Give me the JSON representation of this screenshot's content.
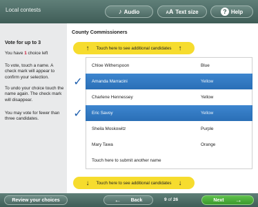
{
  "topbar": {
    "title": "Local contests",
    "audio_label": "Audio",
    "textsize_prefix": "A",
    "textsize_big": "A",
    "textsize_label": "Text size",
    "help_label": "Help",
    "help_symbol": "?"
  },
  "sidebar": {
    "heading": "Vote for up to 3",
    "choice_prefix": "You have ",
    "choice_count": "1",
    "choice_suffix": " choice left",
    "instruction_1": "To vote, touch a name. A check mark will appear to confirm your selection.",
    "instruction_2": "To undo your choice touch the name again. The check mark will disappear.",
    "instruction_3": "You may vote for fewer than three candidates."
  },
  "contest": {
    "title": "County Commissioners",
    "more_top": "Touch here to see additional candidates",
    "more_bottom": "Touch here to see additional candidates",
    "candidates": [
      {
        "name": "Chloe Witherspoon",
        "party": "Blue",
        "selected": false
      },
      {
        "name": "Amanda Marracini",
        "party": "Yellow",
        "selected": true
      },
      {
        "name": "Charlene Hennessey",
        "party": "Yellow",
        "selected": false
      },
      {
        "name": "Eric Savoy",
        "party": "Yellow",
        "selected": true
      },
      {
        "name": "Sheila Moskowitz",
        "party": "Purple",
        "selected": false
      },
      {
        "name": "Mary Tawa",
        "party": "Orange",
        "selected": false
      }
    ],
    "write_in": "Touch here to submit another name"
  },
  "bottombar": {
    "review_label": "Review your choices",
    "back_label": "Back",
    "page_current": "9",
    "page_of": " of ",
    "page_total": "26",
    "next_label": "Next"
  },
  "colors": {
    "bar": "#4f6e68",
    "selected": "#2f77c2",
    "yellow": "#f6dc2e",
    "next": "#4caf3c"
  }
}
